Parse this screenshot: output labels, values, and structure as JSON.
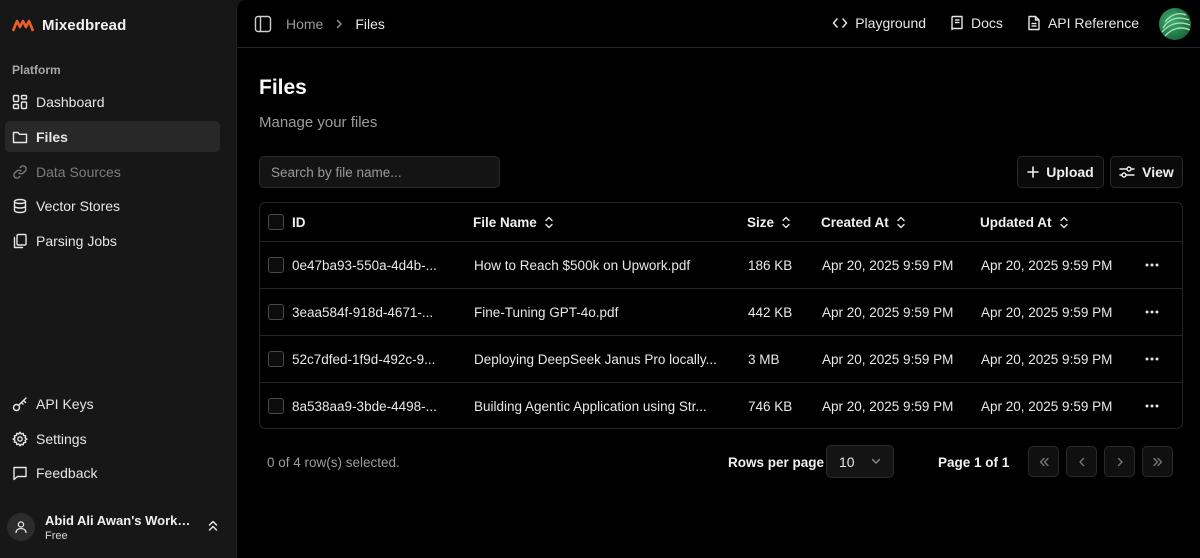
{
  "sidebar": {
    "brand": "Mixedbread",
    "section_label": "Platform",
    "items": [
      {
        "label": "Dashboard",
        "icon": "dashboard-icon"
      },
      {
        "label": "Files",
        "icon": "folder-icon",
        "active": true
      },
      {
        "label": "Data Sources",
        "icon": "link-icon",
        "disabled": true
      },
      {
        "label": "Vector Stores",
        "icon": "database-icon"
      },
      {
        "label": "Parsing Jobs",
        "icon": "copy-icon"
      }
    ],
    "bottom_items": [
      {
        "label": "API Keys",
        "icon": "key-icon"
      },
      {
        "label": "Settings",
        "icon": "gear-icon"
      },
      {
        "label": "Feedback",
        "icon": "message-icon"
      }
    ],
    "workspace": {
      "name": "Abid Ali Awan's Works...",
      "plan": "Free"
    }
  },
  "header": {
    "breadcrumb": [
      "Home",
      "Files"
    ],
    "links": [
      {
        "label": "Playground",
        "icon": "code-icon"
      },
      {
        "label": "Docs",
        "icon": "book-icon"
      },
      {
        "label": "API Reference",
        "icon": "document-icon"
      }
    ]
  },
  "page": {
    "title": "Files",
    "subtitle": "Manage your files"
  },
  "toolbar": {
    "search_placeholder": "Search by file name...",
    "upload_label": "Upload",
    "view_label": "View"
  },
  "table": {
    "columns": [
      "ID",
      "File Name",
      "Size",
      "Created At",
      "Updated At"
    ],
    "rows": [
      {
        "id": "0e47ba93-550a-4d4b-...",
        "name": "How to Reach $500k on Upwork.pdf",
        "size": "186 KB",
        "created": "Apr 20, 2025 9:59 PM",
        "updated": "Apr 20, 2025 9:59 PM"
      },
      {
        "id": "3eaa584f-918d-4671-...",
        "name": "Fine-Tuning GPT-4o.pdf",
        "size": "442 KB",
        "created": "Apr 20, 2025 9:59 PM",
        "updated": "Apr 20, 2025 9:59 PM"
      },
      {
        "id": "52c7dfed-1f9d-492c-9...",
        "name": "Deploying DeepSeek Janus Pro locally...",
        "size": "3 MB",
        "created": "Apr 20, 2025 9:59 PM",
        "updated": "Apr 20, 2025 9:59 PM"
      },
      {
        "id": "8a538aa9-3bde-4498-...",
        "name": "Building Agentic Application using Str...",
        "size": "746 KB",
        "created": "Apr 20, 2025 9:59 PM",
        "updated": "Apr 20, 2025 9:59 PM"
      }
    ]
  },
  "footer": {
    "selection": "0 of 4 row(s) selected.",
    "rows_per_page_label": "Rows per page",
    "rows_per_page_value": "10",
    "page_indicator": "Page 1 of 1"
  },
  "colors": {
    "brand_accent": "#e8612c",
    "background": "#000000",
    "sidebar": "#171717"
  }
}
